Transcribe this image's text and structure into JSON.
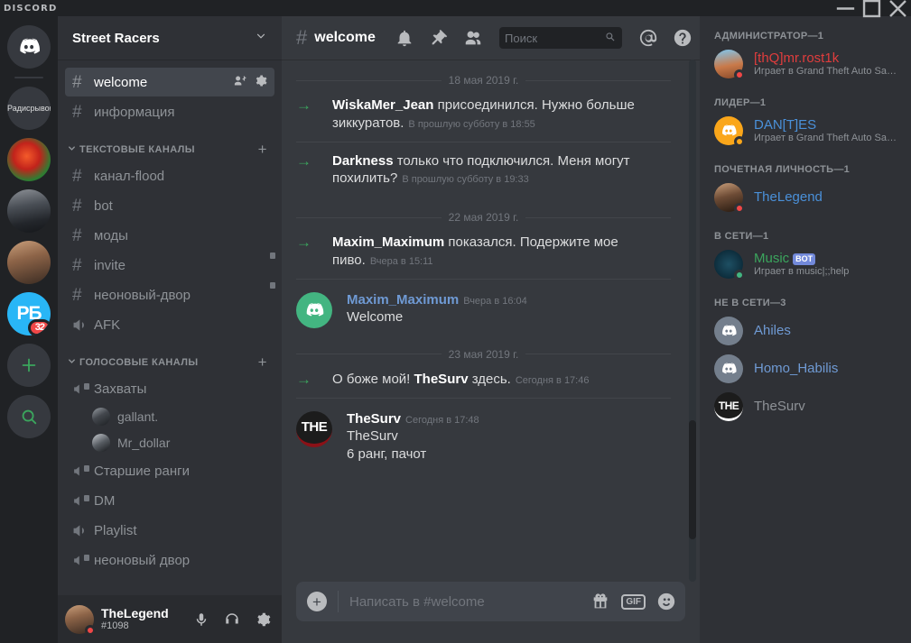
{
  "titlebar": {
    "logo": "DISCORD",
    "minimize": "minimize",
    "maximize": "maximize",
    "close": "close"
  },
  "rail": {
    "home_label": "Discord",
    "servers": [
      {
        "name": "Радисрывов",
        "type": "text",
        "badge": ""
      },
      {
        "name": "server-2",
        "type": "image",
        "badge": ""
      },
      {
        "name": "server-3",
        "type": "image",
        "badge": ""
      },
      {
        "name": "server-4",
        "type": "image",
        "badge": ""
      },
      {
        "name": "РБ",
        "type": "text-logo",
        "badge": "32"
      }
    ],
    "add_label": "+",
    "explore_label": "explore"
  },
  "sidebar": {
    "guild_name": "Street Racers",
    "top_channels": [
      {
        "name": "welcome",
        "active": true,
        "locked": false
      },
      {
        "name": "информация",
        "active": false,
        "locked": false
      }
    ],
    "text_category": "ТЕКСТОВЫЕ КАНАЛЫ",
    "text_channels": [
      {
        "name": "канал-flood",
        "locked": false
      },
      {
        "name": "bot",
        "locked": false
      },
      {
        "name": "моды",
        "locked": false
      },
      {
        "name": "invite",
        "locked": true
      },
      {
        "name": "неоновый-двор",
        "locked": true
      },
      {
        "name": "AFK",
        "locked": false,
        "voice": true
      }
    ],
    "voice_category": "ГОЛОСОВЫЕ КАНАЛЫ",
    "voice_channels": [
      {
        "name": "Захваты",
        "locked": true,
        "users": [
          "gallant.",
          "Mr_dollar"
        ]
      },
      {
        "name": "Старшие ранги",
        "locked": true,
        "users": []
      },
      {
        "name": "DM",
        "locked": true,
        "users": []
      },
      {
        "name": "Playlist",
        "locked": false,
        "users": []
      },
      {
        "name": "неоновый двор",
        "locked": true,
        "users": []
      }
    ],
    "user": {
      "name": "TheLegend",
      "tag": "#1098",
      "mute_label": "Выключить микрофон",
      "deafen_label": "Выключить звук",
      "settings_label": "Настройки пользователя"
    }
  },
  "header": {
    "channel_name": "welcome",
    "notifications_label": "Уведомления",
    "pinned_label": "Закрепленные сообщения",
    "members_label": "Список участников",
    "mentions_label": "Упоминания",
    "help_label": "Помощь"
  },
  "search": {
    "placeholder": "Поиск"
  },
  "messages": [
    {
      "kind": "divider",
      "label": "18 мая 2019 г."
    },
    {
      "kind": "system",
      "who": "WiskaMer_Jean",
      "text": " присоединился. Нужно больше зиккуратов.",
      "time": "В прошлую субботу в 18:55"
    },
    {
      "kind": "system",
      "who": "Darkness",
      "text": " только что подключился. Меня могут похилить?",
      "time": "В прошлую субботу в 19:33"
    },
    {
      "kind": "divider",
      "label": "22 мая 2019 г."
    },
    {
      "kind": "system",
      "who": "Maxim_Maximum",
      "text": " показался. Подержите мое пиво.",
      "time": "Вчера в 15:11"
    },
    {
      "kind": "user",
      "author": "Maxim_Maximum",
      "time": "Вчера в 16:04",
      "avatar": "discord",
      "lines": [
        "Welcome"
      ]
    },
    {
      "kind": "divider",
      "label": "23 мая 2019 г."
    },
    {
      "kind": "system_prefix",
      "prefix": "О боже мой! ",
      "who": "TheSurv",
      "text": " здесь.",
      "time": "Сегодня в 17:46"
    },
    {
      "kind": "user",
      "author": "TheSurv",
      "time": "Сегодня в 17:48",
      "avatar": "THE",
      "lines": [
        "TheSurv",
        "6 ранг, пачот"
      ]
    }
  ],
  "composer": {
    "placeholder": "Написать в #welcome",
    "upload_label": "+",
    "gift_label": "Подарок Nitro",
    "gif_label": "GIF",
    "emoji_label": "Эмодзи"
  },
  "members": {
    "groups": [
      {
        "title": "АДМИНИСТРАТОР—1",
        "entries": [
          {
            "name": "[thQ]mr.rost1k",
            "color": "#e03d3d",
            "status": "dnd",
            "activity": "Играет в Grand Theft Auto San A...",
            "avatar": "sky"
          }
        ]
      },
      {
        "title": "ЛИДЕР—1",
        "entries": [
          {
            "name": "DAN[T]ES",
            "color": "#4a90d9",
            "status": "idle",
            "activity": "Играет в Grand Theft Auto San A...",
            "avatar": "yellow-discord"
          }
        ]
      },
      {
        "title": "ПОЧЕТНАЯ ЛИЧНОСТЬ—1",
        "entries": [
          {
            "name": "TheLegend",
            "color": "#4a90d9",
            "status": "dnd",
            "activity": "",
            "avatar": "face"
          }
        ]
      },
      {
        "title": "В СЕТИ—1",
        "entries": [
          {
            "name": "Music",
            "color": "#3ba55d",
            "status": "online",
            "activity": "Играет в music|;;help",
            "avatar": "music",
            "bot": "BOT"
          }
        ]
      },
      {
        "title": "НЕ В СЕТИ—3",
        "entries": [
          {
            "name": "Ahiles",
            "color": "#6f9ad4",
            "status": "",
            "activity": "",
            "avatar": "offline-discord"
          },
          {
            "name": "Homo_Habilis",
            "color": "#6f9ad4",
            "status": "",
            "activity": "",
            "avatar": "offline-discord"
          },
          {
            "name": "TheSurv",
            "color": "#8e9297",
            "status": "",
            "activity": "",
            "avatar": "THE"
          }
        ]
      }
    ]
  },
  "colors": {
    "brand": "#7289da",
    "online": "#43b581",
    "dnd": "#f04747",
    "idle": "#faa61a",
    "badge": "#f04747",
    "sidebar_bg": "#2f3136",
    "chat_bg": "#36393e",
    "rail_bg": "#202225"
  }
}
